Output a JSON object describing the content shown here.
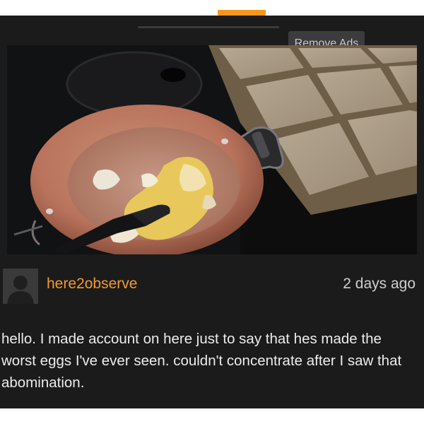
{
  "header": {
    "remove_ads_label": "Remove Ads"
  },
  "video": {
    "description_icon": "video-frame-eggs-in-pan"
  },
  "comment": {
    "username": "here2observe",
    "timestamp": "2 days ago",
    "text": "hello. I made account on here just to say that hes made the worst eggs I've ever seen. couldn't concentrate after I saw that abomination."
  },
  "colors": {
    "accent": "#f39a2b",
    "background": "#1b1b1b",
    "button_bg": "#3c3c3c"
  }
}
